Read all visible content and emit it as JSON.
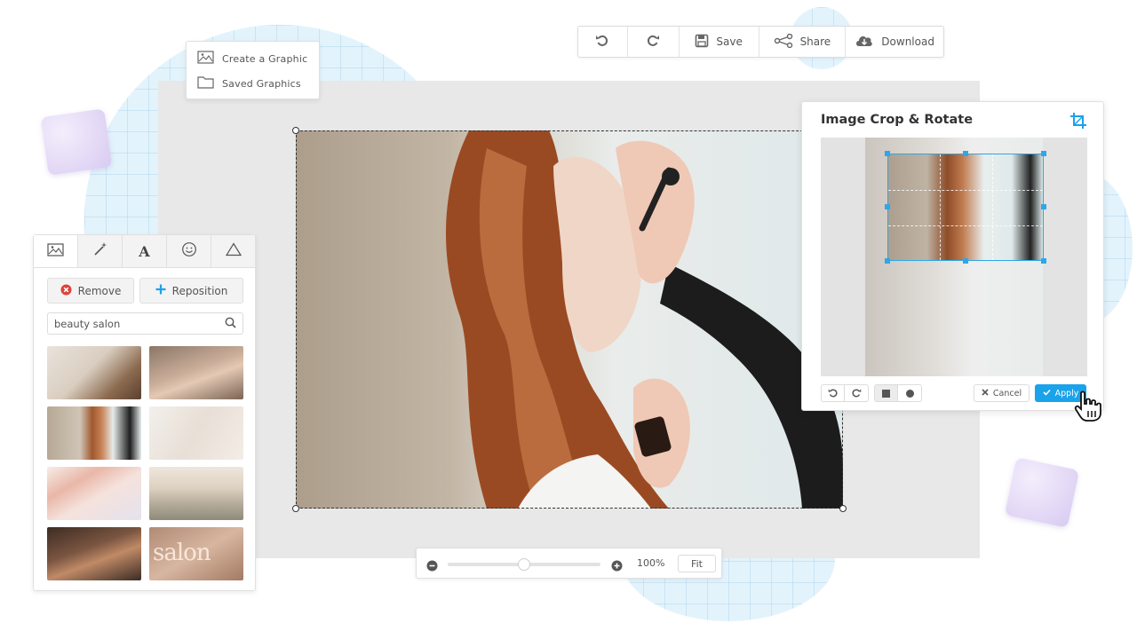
{
  "toolbar": {
    "undo_icon": "undo-icon",
    "redo_icon": "redo-icon",
    "save_label": "Save",
    "share_label": "Share",
    "download_label": "Download"
  },
  "menu": {
    "items": [
      {
        "label": "Create a Graphic",
        "icon": "image-icon"
      },
      {
        "label": "Saved Graphics",
        "icon": "folder-icon"
      }
    ]
  },
  "left_panel": {
    "tabs": [
      "image-icon",
      "magic-wand-icon",
      "text-icon",
      "emoji-icon",
      "shape-icon"
    ],
    "remove_label": "Remove",
    "reposition_label": "Reposition",
    "search": {
      "value": "beauty salon",
      "icon": "search-icon"
    }
  },
  "zoom": {
    "level": 0.5,
    "percent_label": "100%",
    "fit_label": "Fit"
  },
  "crop_dialog": {
    "title": "Image Crop & Rotate",
    "cancel_label": "Cancel",
    "apply_label": "Apply"
  },
  "colors": {
    "accent": "#1aa2ea",
    "remove_red": "#e0413a",
    "reposition_blue": "#1aa2ea",
    "canvas_gray": "#e8e8e8"
  }
}
